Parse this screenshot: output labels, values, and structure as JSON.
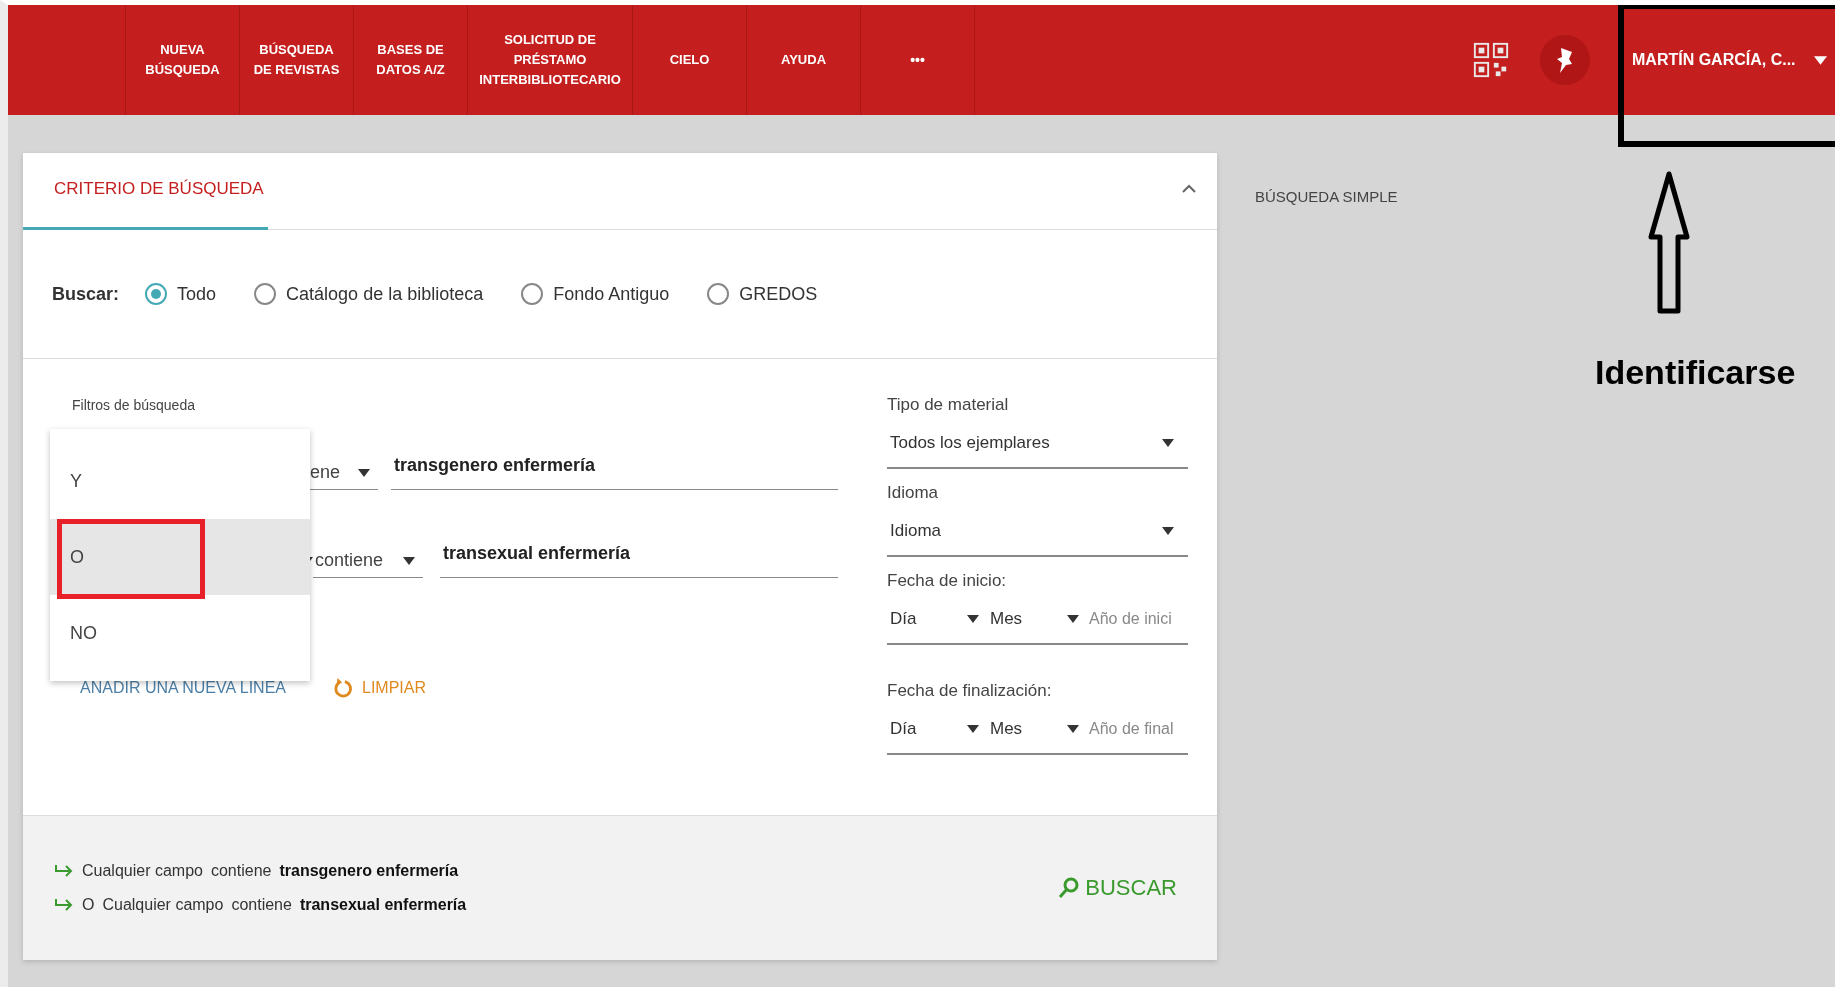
{
  "nav": {
    "items": [
      {
        "label": "NUEVA\nBÚSQUEDA"
      },
      {
        "label": "BÚSQUEDA\nDE REVISTAS"
      },
      {
        "label": "BASES DE\nDATOS A/Z"
      },
      {
        "label": "SOLICITUD DE\nPRÉSTAMO\nINTERBIBLIOTECARIO"
      },
      {
        "label": "CIELO"
      },
      {
        "label": "AYUDA"
      },
      {
        "label": "•••"
      }
    ],
    "user": "MARTÍN GARCÍA, C..."
  },
  "search_panel": {
    "tab": "CRITERIO DE BÚSQUEDA",
    "expanded": true,
    "scope_label": "Buscar:",
    "scopes": [
      {
        "label": "Todo",
        "selected": true
      },
      {
        "label": "Catálogo de la biblioteca",
        "selected": false
      },
      {
        "label": "Fondo Antiguo",
        "selected": false
      },
      {
        "label": "GREDOS",
        "selected": false
      }
    ],
    "filters_label": "Filtros de búsqueda",
    "rows": [
      {
        "kind": "first",
        "operator": "ene",
        "value": "transgenero enfermería"
      },
      {
        "kind": "joined",
        "operator": "contiene",
        "value": "transexual enfermería"
      }
    ],
    "logic_menu": [
      {
        "label": "Y",
        "selected": false
      },
      {
        "label": "O",
        "selected": true
      },
      {
        "label": "NO",
        "selected": false
      }
    ],
    "add_line": "AÑADIR UNA NUEVA LÍNEA",
    "clear": "LIMPIAR",
    "material": {
      "label": "Tipo de material",
      "value": "Todos los ejemplares"
    },
    "language": {
      "label": "Idioma",
      "value": "Idioma"
    },
    "dates": [
      {
        "label": "Fecha de inicio:",
        "day": "Día",
        "month": "Mes",
        "year_placeholder": "Año de inici"
      },
      {
        "label": "Fecha de finalización:",
        "day": "Día",
        "month": "Mes",
        "year_placeholder": "Año de final"
      }
    ],
    "summary": [
      {
        "field": "Cualquier campo",
        "operator": "contiene",
        "value": "transgenero enfermería"
      },
      {
        "prefix": "O",
        "field": "Cualquier campo",
        "operator": "contiene",
        "value": "transexual enfermería"
      }
    ],
    "search_button": "BUSCAR"
  },
  "side_link": "BÚSQUEDA SIMPLE",
  "annotation": {
    "label": "Identificarse"
  }
}
